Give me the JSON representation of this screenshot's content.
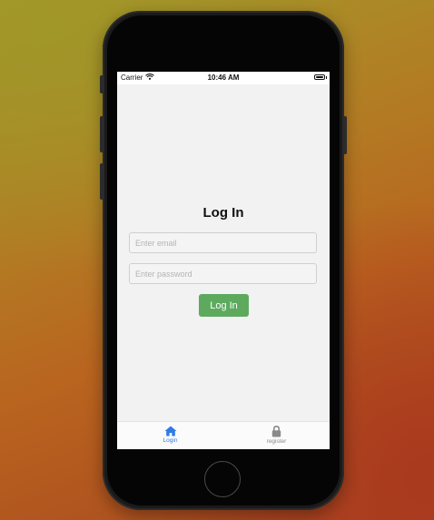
{
  "status_bar": {
    "carrier": "Carrier",
    "time": "10:46 AM",
    "icons": [
      "wifi-icon",
      "battery-icon"
    ]
  },
  "login": {
    "title": "Log In",
    "email_placeholder": "Enter email",
    "password_placeholder": "Enter password",
    "button_label": "Log In"
  },
  "tabs": [
    {
      "label": "Login",
      "icon": "home-icon",
      "active": true
    },
    {
      "label": "register",
      "icon": "lock-icon",
      "active": false
    }
  ],
  "colors": {
    "accent": "#2f7be4",
    "button": "#5daa5f",
    "screen_bg": "#f2f2f2"
  }
}
